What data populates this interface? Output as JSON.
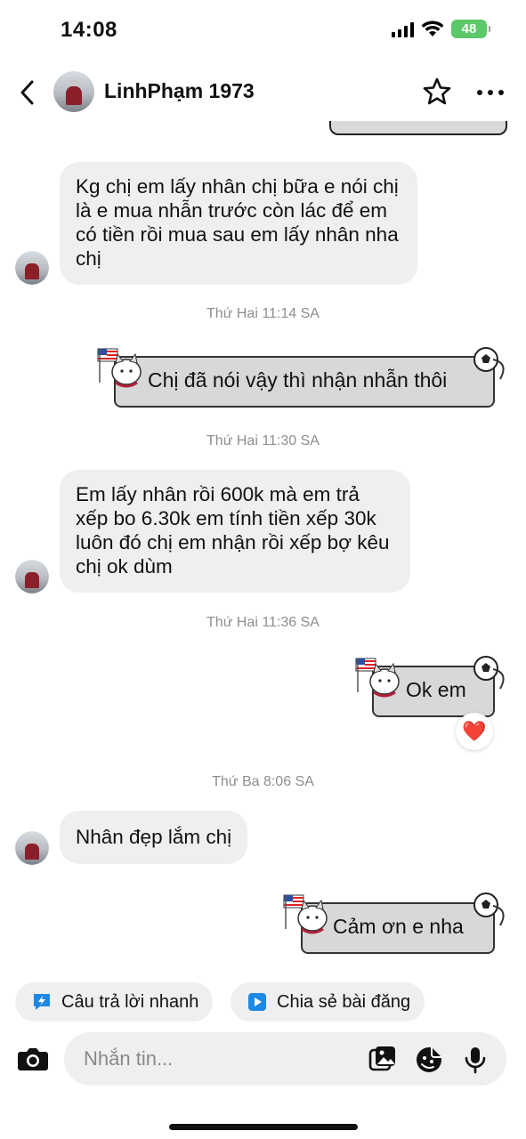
{
  "status_bar": {
    "time": "14:08",
    "battery": "48"
  },
  "header": {
    "contact_name": "LinhPhạm 1973"
  },
  "messages": {
    "m1": "Kg chị em lấy nhân chị bữa e nói chị là e mua nhẫn trước còn lác để em có tiền rồi mua sau em lấy nhân nha chị",
    "t1": "Thứ Hai 11:14 SA",
    "m2": "Chị đã nói vậy thì nhận nhẫn thôi",
    "t2": "Thứ Hai 11:30 SA",
    "m3": "Em lấy nhân rồi 600k mà em trả xếp bo 6.30k em tính tiền xếp 30k luôn đó chị em nhận rồi xếp bợ kêu chị ok dùm",
    "t3": "Thứ Hai 11:36 SA",
    "m4": "Ok em",
    "m4_reaction": "❤️",
    "t4": "Thứ Ba 8:06 SA",
    "m5": "Nhân đẹp lắm chị",
    "m6": "Cảm ơn e nha"
  },
  "quick_actions": {
    "quick_reply": "Câu trả lời nhanh",
    "share_post": "Chia sẻ bài đăng"
  },
  "composer": {
    "placeholder": "Nhắn tin..."
  },
  "icons": {
    "back": "back-chevron-icon",
    "star": "star-icon",
    "more": "more-dots-icon",
    "camera": "camera-icon",
    "gallery": "gallery-icon",
    "sticker": "sticker-icon",
    "mic": "microphone-icon",
    "quick_reply": "quick-reply-icon",
    "share": "share-post-icon"
  },
  "colors": {
    "quick_reply_icon": "#1e88e5",
    "share_icon": "#1e88e5",
    "reaction": "#e0163c",
    "battery": "#5bc86a"
  }
}
